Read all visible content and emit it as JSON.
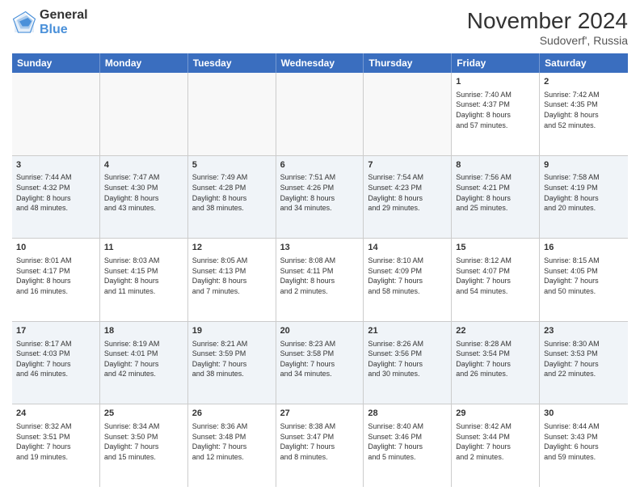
{
  "header": {
    "logo_line1": "General",
    "logo_line2": "Blue",
    "month": "November 2024",
    "location": "Sudoverf', Russia"
  },
  "days_of_week": [
    "Sunday",
    "Monday",
    "Tuesday",
    "Wednesday",
    "Thursday",
    "Friday",
    "Saturday"
  ],
  "weeks": [
    [
      {
        "day": "",
        "info": ""
      },
      {
        "day": "",
        "info": ""
      },
      {
        "day": "",
        "info": ""
      },
      {
        "day": "",
        "info": ""
      },
      {
        "day": "",
        "info": ""
      },
      {
        "day": "1",
        "info": "Sunrise: 7:40 AM\nSunset: 4:37 PM\nDaylight: 8 hours\nand 57 minutes."
      },
      {
        "day": "2",
        "info": "Sunrise: 7:42 AM\nSunset: 4:35 PM\nDaylight: 8 hours\nand 52 minutes."
      }
    ],
    [
      {
        "day": "3",
        "info": "Sunrise: 7:44 AM\nSunset: 4:32 PM\nDaylight: 8 hours\nand 48 minutes."
      },
      {
        "day": "4",
        "info": "Sunrise: 7:47 AM\nSunset: 4:30 PM\nDaylight: 8 hours\nand 43 minutes."
      },
      {
        "day": "5",
        "info": "Sunrise: 7:49 AM\nSunset: 4:28 PM\nDaylight: 8 hours\nand 38 minutes."
      },
      {
        "day": "6",
        "info": "Sunrise: 7:51 AM\nSunset: 4:26 PM\nDaylight: 8 hours\nand 34 minutes."
      },
      {
        "day": "7",
        "info": "Sunrise: 7:54 AM\nSunset: 4:23 PM\nDaylight: 8 hours\nand 29 minutes."
      },
      {
        "day": "8",
        "info": "Sunrise: 7:56 AM\nSunset: 4:21 PM\nDaylight: 8 hours\nand 25 minutes."
      },
      {
        "day": "9",
        "info": "Sunrise: 7:58 AM\nSunset: 4:19 PM\nDaylight: 8 hours\nand 20 minutes."
      }
    ],
    [
      {
        "day": "10",
        "info": "Sunrise: 8:01 AM\nSunset: 4:17 PM\nDaylight: 8 hours\nand 16 minutes."
      },
      {
        "day": "11",
        "info": "Sunrise: 8:03 AM\nSunset: 4:15 PM\nDaylight: 8 hours\nand 11 minutes."
      },
      {
        "day": "12",
        "info": "Sunrise: 8:05 AM\nSunset: 4:13 PM\nDaylight: 8 hours\nand 7 minutes."
      },
      {
        "day": "13",
        "info": "Sunrise: 8:08 AM\nSunset: 4:11 PM\nDaylight: 8 hours\nand 2 minutes."
      },
      {
        "day": "14",
        "info": "Sunrise: 8:10 AM\nSunset: 4:09 PM\nDaylight: 7 hours\nand 58 minutes."
      },
      {
        "day": "15",
        "info": "Sunrise: 8:12 AM\nSunset: 4:07 PM\nDaylight: 7 hours\nand 54 minutes."
      },
      {
        "day": "16",
        "info": "Sunrise: 8:15 AM\nSunset: 4:05 PM\nDaylight: 7 hours\nand 50 minutes."
      }
    ],
    [
      {
        "day": "17",
        "info": "Sunrise: 8:17 AM\nSunset: 4:03 PM\nDaylight: 7 hours\nand 46 minutes."
      },
      {
        "day": "18",
        "info": "Sunrise: 8:19 AM\nSunset: 4:01 PM\nDaylight: 7 hours\nand 42 minutes."
      },
      {
        "day": "19",
        "info": "Sunrise: 8:21 AM\nSunset: 3:59 PM\nDaylight: 7 hours\nand 38 minutes."
      },
      {
        "day": "20",
        "info": "Sunrise: 8:23 AM\nSunset: 3:58 PM\nDaylight: 7 hours\nand 34 minutes."
      },
      {
        "day": "21",
        "info": "Sunrise: 8:26 AM\nSunset: 3:56 PM\nDaylight: 7 hours\nand 30 minutes."
      },
      {
        "day": "22",
        "info": "Sunrise: 8:28 AM\nSunset: 3:54 PM\nDaylight: 7 hours\nand 26 minutes."
      },
      {
        "day": "23",
        "info": "Sunrise: 8:30 AM\nSunset: 3:53 PM\nDaylight: 7 hours\nand 22 minutes."
      }
    ],
    [
      {
        "day": "24",
        "info": "Sunrise: 8:32 AM\nSunset: 3:51 PM\nDaylight: 7 hours\nand 19 minutes."
      },
      {
        "day": "25",
        "info": "Sunrise: 8:34 AM\nSunset: 3:50 PM\nDaylight: 7 hours\nand 15 minutes."
      },
      {
        "day": "26",
        "info": "Sunrise: 8:36 AM\nSunset: 3:48 PM\nDaylight: 7 hours\nand 12 minutes."
      },
      {
        "day": "27",
        "info": "Sunrise: 8:38 AM\nSunset: 3:47 PM\nDaylight: 7 hours\nand 8 minutes."
      },
      {
        "day": "28",
        "info": "Sunrise: 8:40 AM\nSunset: 3:46 PM\nDaylight: 7 hours\nand 5 minutes."
      },
      {
        "day": "29",
        "info": "Sunrise: 8:42 AM\nSunset: 3:44 PM\nDaylight: 7 hours\nand 2 minutes."
      },
      {
        "day": "30",
        "info": "Sunrise: 8:44 AM\nSunset: 3:43 PM\nDaylight: 6 hours\nand 59 minutes."
      }
    ]
  ]
}
